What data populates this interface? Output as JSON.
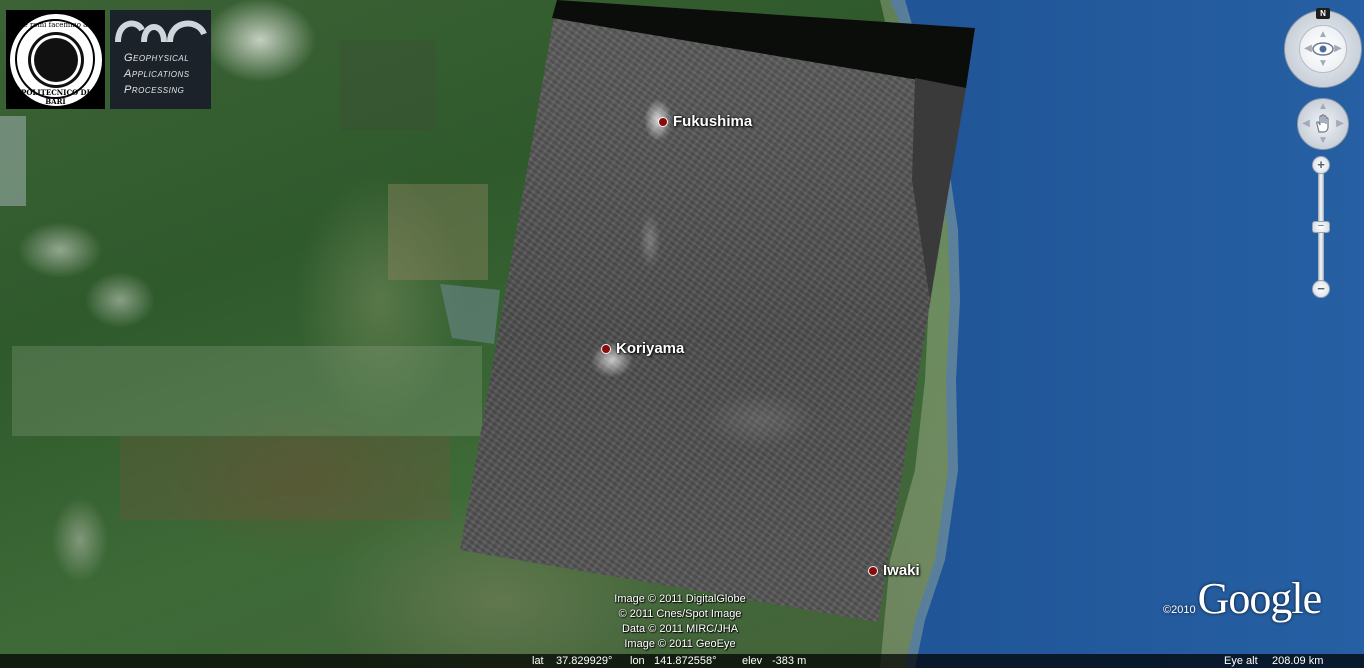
{
  "places": [
    {
      "id": "fukushima",
      "label": "Fukushima"
    },
    {
      "id": "koriyama",
      "label": "Koriyama"
    },
    {
      "id": "iwaki",
      "label": "Iwaki"
    }
  ],
  "logos": {
    "poliba": {
      "top_text": "de remi facemmo ali",
      "bottom_text": "POLITECNICO DI BARI"
    },
    "gap": {
      "line1": "Geophysical",
      "line2": "Applications",
      "line3": "Processing"
    }
  },
  "attribution": [
    "Image © 2011 DigitalGlobe",
    "© 2011 Cnes/Spot Image",
    "Data © 2011 MIRC/JHA",
    "Image © 2011 GeoEye"
  ],
  "branding": {
    "copyright_year": "©2010",
    "wordmark": "Google"
  },
  "status": {
    "lat_label": "lat",
    "lat_value": "37.829929°",
    "lon_label": "lon",
    "lon_value": "141.872558°",
    "elev_label": "elev",
    "elev_value": "-383 m",
    "eye_alt_label": "Eye alt",
    "eye_alt_value": "208.09 km"
  },
  "navigation": {
    "north_label": "N",
    "zoom_in_label": "+",
    "zoom_out_label": "−",
    "zoom_level": 0.5,
    "icons": [
      "look-joystick-icon",
      "eye-icon",
      "move-joystick-icon",
      "hand-icon",
      "zoom-in-icon",
      "zoom-out-icon"
    ]
  },
  "colors": {
    "ocean": "#1b4e8e",
    "place_marker": "#8b0a0a"
  }
}
